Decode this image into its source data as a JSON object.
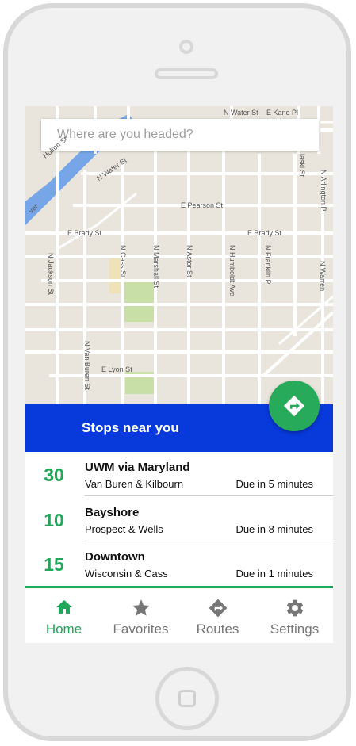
{
  "search": {
    "placeholder": "Where are you headed?"
  },
  "map": {
    "streets": [
      "N Water St",
      "E Kane Pl",
      "N Water St",
      "E Pearson St",
      "E Brady St",
      "E Brady St",
      "N Jackson St",
      "N Cass St",
      "N Marshall St",
      "N Astor St",
      "N Humboldt Ave",
      "N Franklin Pl",
      "N Van Buren St",
      "E Lyon St",
      "N Arlington Pl",
      "N Warren",
      "Holton St",
      "ver",
      "laski St"
    ]
  },
  "header": {
    "title": "Stops near you"
  },
  "stops": [
    {
      "route": "30",
      "name": "UWM via Maryland",
      "location": "Van Buren & Kilbourn",
      "due": "Due in 5 minutes"
    },
    {
      "route": "10",
      "name": "Bayshore",
      "location": "Prospect & Wells",
      "due": "Due in 8 minutes"
    },
    {
      "route": "15",
      "name": "Downtown",
      "location": "Wisconsin & Cass",
      "due": "Due in 1 minutes"
    }
  ],
  "nav": {
    "items": [
      {
        "label": "Home",
        "icon": "home-icon"
      },
      {
        "label": "Favorites",
        "icon": "star-icon"
      },
      {
        "label": "Routes",
        "icon": "directions-icon"
      },
      {
        "label": "Settings",
        "icon": "gear-icon"
      }
    ]
  },
  "colors": {
    "accent": "#1fa75a",
    "header": "#0839db",
    "fab": "#27ab5a"
  }
}
